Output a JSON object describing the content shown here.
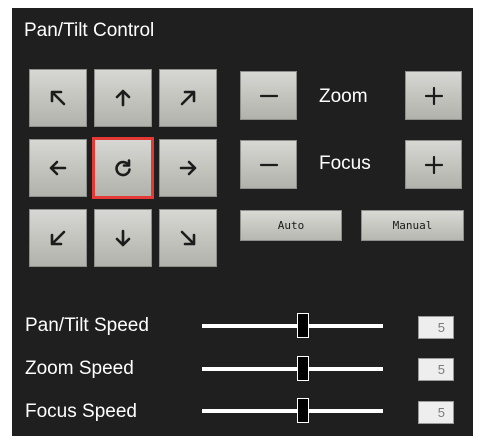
{
  "panel": {
    "title": "Pan/Tilt Control"
  },
  "ptz": {
    "buttons": [
      {
        "name": "up-left-arrow-icon",
        "glyph": "↖"
      },
      {
        "name": "up-arrow-icon",
        "glyph": "↑"
      },
      {
        "name": "up-right-arrow-icon",
        "glyph": "↗"
      },
      {
        "name": "left-arrow-icon",
        "glyph": "←"
      },
      {
        "name": "home-reset-icon",
        "glyph": "↻",
        "highlighted": true
      },
      {
        "name": "right-arrow-icon",
        "glyph": "→"
      },
      {
        "name": "down-left-arrow-icon",
        "glyph": "↙"
      },
      {
        "name": "down-arrow-icon",
        "glyph": "↓"
      },
      {
        "name": "down-right-arrow-icon",
        "glyph": "↘"
      }
    ]
  },
  "lens": {
    "zoom_label": "Zoom",
    "focus_label": "Focus",
    "minus_icon": "minus-icon",
    "plus_icon": "plus-icon",
    "auto_label": "Auto",
    "manual_label": "Manual"
  },
  "speeds": [
    {
      "label": "Pan/Tilt Speed",
      "value": "5",
      "level": 0.56
    },
    {
      "label": "Zoom Speed",
      "value": "5",
      "level": 0.56
    },
    {
      "label": "Focus Speed",
      "value": "5",
      "level": 0.56
    }
  ],
  "colors": {
    "panel_bg": "#1f1f1f",
    "button_top": "#d7d7d3",
    "button_bottom": "#b2b2ac",
    "highlight_border": "#e53935",
    "text": "#ffffff"
  }
}
